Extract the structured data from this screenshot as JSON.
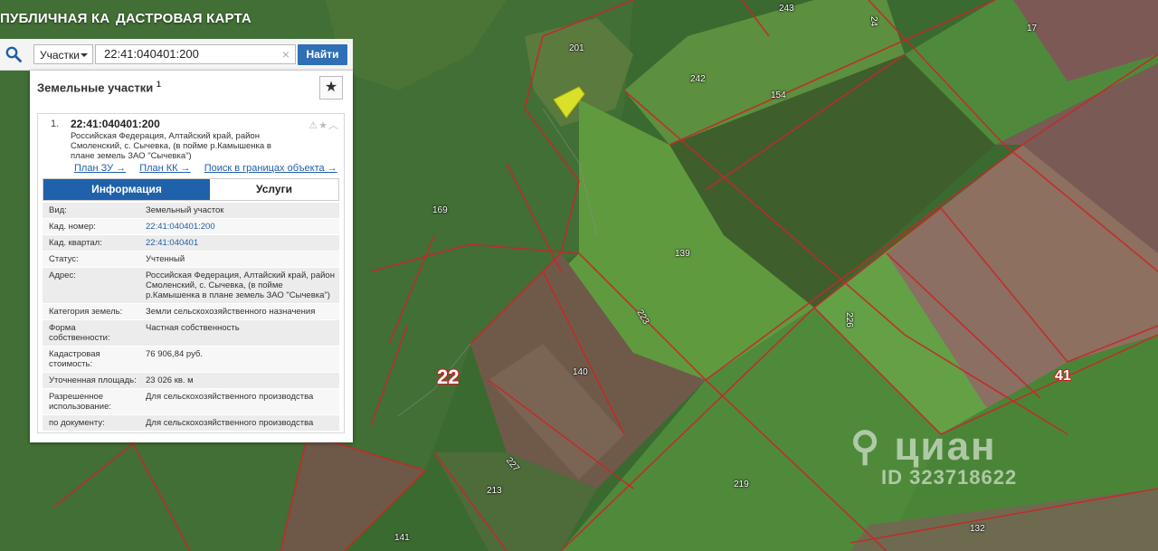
{
  "app": {
    "title_prefix": "ПУБЛИЧНАЯ КА",
    "title": "ДАСТРОВАЯ КАРТА"
  },
  "search": {
    "type_selected": "Участки",
    "query": "22:41:040401:200",
    "clear_icon": "close-icon",
    "button_label": "Найти"
  },
  "panel": {
    "header": "Земельные участки",
    "count": "1",
    "result": {
      "index": "1.",
      "cadastral_number": "22:41:040401:200",
      "address": "Российская Федерация, Алтайский край, район Смоленский, с. Сычевка, (в пойме р.Камышенка в плане земель ЗАО \"Сычевка\")",
      "icons": "⚠★︿",
      "links": [
        "План ЗУ →",
        "План КК →",
        "Поиск в границах объекта →"
      ],
      "tabs": [
        "Информация",
        "Услуги"
      ],
      "properties": [
        {
          "key": "Вид:",
          "value": "Земельный участок"
        },
        {
          "key": "Кад. номер:",
          "value": "22:41:040401:200"
        },
        {
          "key": "Кад. квартал:",
          "value": "22:41:040401"
        },
        {
          "key": "Статус:",
          "value": "Учтенный"
        },
        {
          "key": "Адрес:",
          "value": "Российская Федерация, Алтайский край, район Смоленский, с. Сычевка, (в пойме р.Камышенка в плане земель ЗАО \"Сычевка\")"
        },
        {
          "key": "Категория земель:",
          "value": "Земли сельскохозяйственного назначения"
        },
        {
          "key": "Форма собственности:",
          "value": "Частная собственность"
        },
        {
          "key": "Кадастровая стоимость:",
          "value": "76 906,84 руб."
        },
        {
          "key": "Уточненная площадь:",
          "value": "23 026 кв. м"
        },
        {
          "key": "Разрешенное использование:",
          "value": "Для сельскохозяйственного производства"
        },
        {
          "key": "по документу:",
          "value": "Для сельскохозяйственного производства"
        }
      ]
    }
  },
  "map": {
    "parcel_labels": [
      "243",
      "24",
      "17",
      "201",
      "242",
      "154",
      "169",
      "139",
      "223",
      "226",
      "140",
      "227",
      "213",
      "219",
      "132",
      "141"
    ],
    "region_labels": [
      "22",
      "41"
    ],
    "watermark": {
      "brand": "циан",
      "id_text": "ID 323718622"
    }
  },
  "colors": {
    "accent": "#2f6fb5",
    "boundary": "#c62828",
    "selected_parcel": "#d8e02a"
  }
}
